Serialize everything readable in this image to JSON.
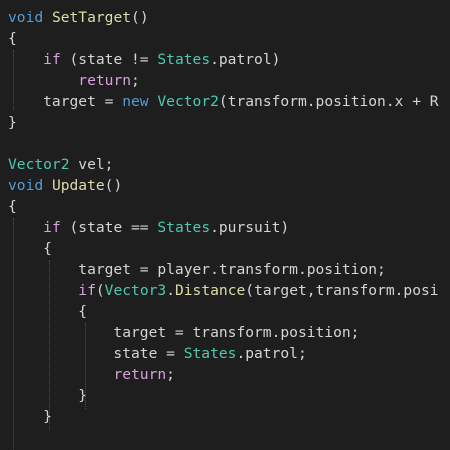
{
  "colors": {
    "background": "#1e1e1e",
    "plain": "#d4d4d4",
    "keyword": "#569cd6",
    "control_keyword": "#d8a0df",
    "type": "#4ec9b0",
    "method": "#dcdcaa",
    "indent_guide": "#4a4a4a"
  },
  "code_lines": [
    [
      {
        "t": "void",
        "c": "kw-blue"
      },
      {
        "t": " ",
        "c": "plain"
      },
      {
        "t": "SetTarget",
        "c": "method"
      },
      {
        "t": "()",
        "c": "plain"
      }
    ],
    [
      {
        "t": "{",
        "c": "plain"
      }
    ],
    [
      {
        "t": "    ",
        "c": "plain"
      },
      {
        "t": "if",
        "c": "kw-ctrl"
      },
      {
        "t": " (state != ",
        "c": "plain"
      },
      {
        "t": "States",
        "c": "type"
      },
      {
        "t": ".patrol)",
        "c": "plain"
      }
    ],
    [
      {
        "t": "        ",
        "c": "plain"
      },
      {
        "t": "return",
        "c": "kw-ctrl"
      },
      {
        "t": ";",
        "c": "plain"
      }
    ],
    [
      {
        "t": "    target = ",
        "c": "plain"
      },
      {
        "t": "new",
        "c": "kw-blue"
      },
      {
        "t": " ",
        "c": "plain"
      },
      {
        "t": "Vector2",
        "c": "type"
      },
      {
        "t": "(transform.position.x + R",
        "c": "plain"
      }
    ],
    [
      {
        "t": "}",
        "c": "plain"
      }
    ],
    [],
    [
      {
        "t": "Vector2",
        "c": "type"
      },
      {
        "t": " vel;",
        "c": "plain"
      }
    ],
    [
      {
        "t": "void",
        "c": "kw-blue"
      },
      {
        "t": " ",
        "c": "plain"
      },
      {
        "t": "Update",
        "c": "method"
      },
      {
        "t": "()",
        "c": "plain"
      }
    ],
    [
      {
        "t": "{",
        "c": "plain"
      }
    ],
    [
      {
        "t": "    ",
        "c": "plain"
      },
      {
        "t": "if",
        "c": "kw-ctrl"
      },
      {
        "t": " (state == ",
        "c": "plain"
      },
      {
        "t": "States",
        "c": "type"
      },
      {
        "t": ".pursuit)",
        "c": "plain"
      }
    ],
    [
      {
        "t": "    {",
        "c": "plain"
      }
    ],
    [
      {
        "t": "        target = player.transform.position;",
        "c": "plain"
      }
    ],
    [
      {
        "t": "        ",
        "c": "plain"
      },
      {
        "t": "if",
        "c": "kw-ctrl"
      },
      {
        "t": "(",
        "c": "plain"
      },
      {
        "t": "Vector3",
        "c": "type"
      },
      {
        "t": ".",
        "c": "plain"
      },
      {
        "t": "Distance",
        "c": "method"
      },
      {
        "t": "(target,transform.posi",
        "c": "plain"
      }
    ],
    [
      {
        "t": "        {",
        "c": "plain"
      }
    ],
    [
      {
        "t": "            target = transform.position;",
        "c": "plain"
      }
    ],
    [
      {
        "t": "            state = ",
        "c": "plain"
      },
      {
        "t": "States",
        "c": "type"
      },
      {
        "t": ".patrol;",
        "c": "plain"
      }
    ],
    [
      {
        "t": "            ",
        "c": "plain"
      },
      {
        "t": "return",
        "c": "kw-ctrl"
      },
      {
        "t": ";",
        "c": "plain"
      }
    ],
    [
      {
        "t": "        }",
        "c": "plain"
      }
    ],
    [
      {
        "t": "    }",
        "c": "plain"
      }
    ],
    []
  ]
}
